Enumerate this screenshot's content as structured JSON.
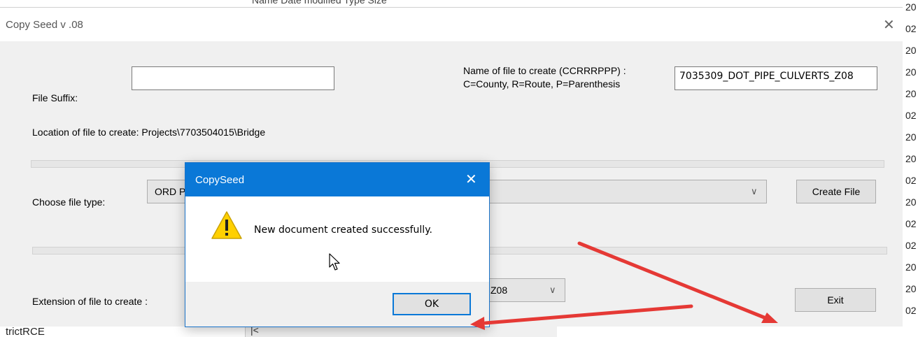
{
  "background": {
    "top_text": "Name  Date modified  Type  Size",
    "bottom_left_text": "trictRCE",
    "bottom_scroll_arrow": "|<",
    "right_strip_chars": [
      "20",
      "02",
      "20",
      "20",
      "20",
      "02",
      "20",
      "20",
      "02",
      "20",
      "02",
      "02",
      "20",
      "20",
      "02"
    ]
  },
  "main_window": {
    "title": "Copy Seed v .08",
    "close_glyph": "✕",
    "file_suffix_label": "File Suffix:",
    "file_suffix_value": "",
    "name_label_line1": "Name of file to create (CCRRRPPP) :",
    "name_label_line2": "C=County, R=Route, P=Parenthesis",
    "name_value": "7035309_DOT_PIPE_CULVERTS_Z08",
    "location_label": "Location of file to create:  Projects\\7703504015\\Bridge",
    "file_type_label": "Choose file type:",
    "file_type_value": "ORD P",
    "create_file_button": "Create File",
    "extension_label": "Extension of file to create :",
    "extension_value": "Z08",
    "exit_button": "Exit"
  },
  "dialog": {
    "title": "CopySeed",
    "close_glyph": "✕",
    "message": "New document created successfully.",
    "ok_button": "OK"
  },
  "annotations": {
    "arrow_color": "#e53935"
  }
}
